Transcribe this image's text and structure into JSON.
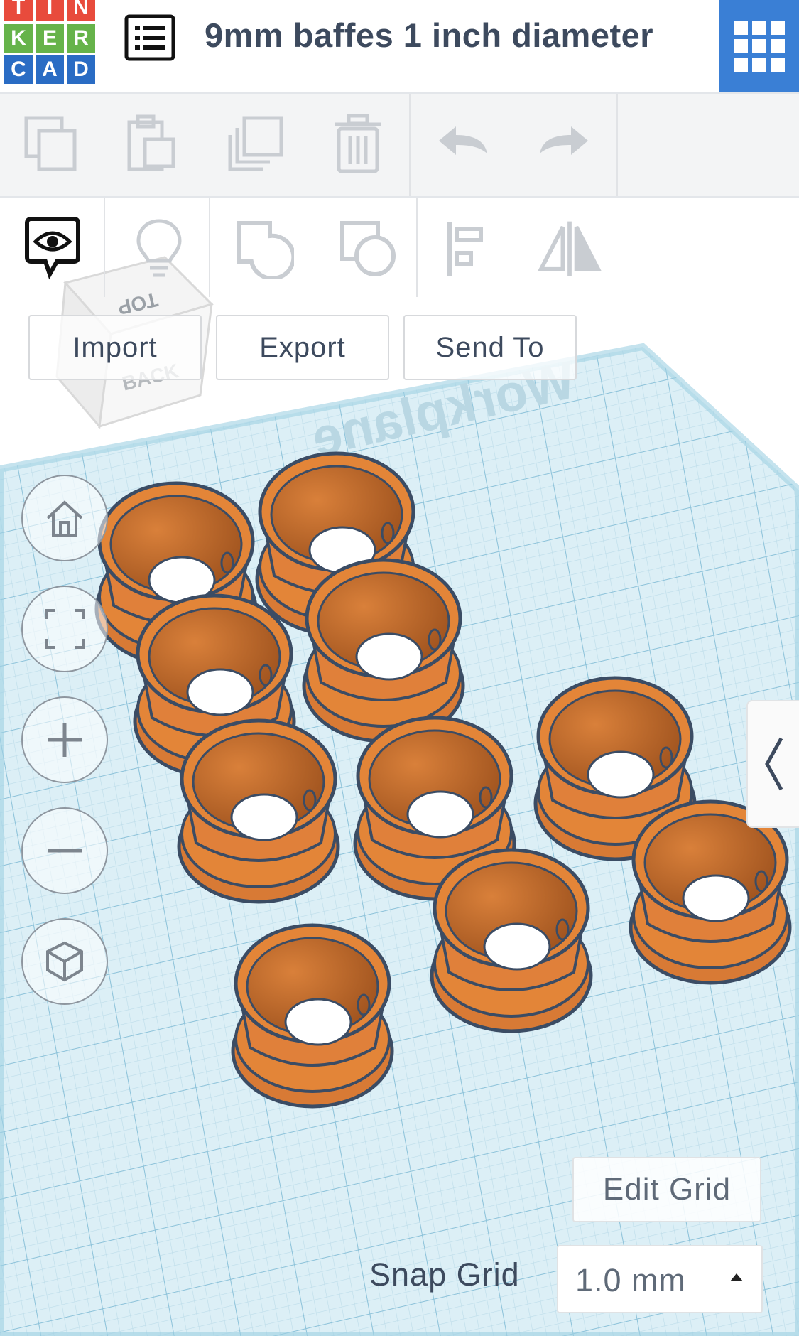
{
  "app": {
    "logo_letters": [
      "T",
      "I",
      "N",
      "K",
      "E",
      "R",
      "C",
      "A",
      "D"
    ],
    "logo_colors": [
      "#e84b3c",
      "#e84b3c",
      "#e84b3c",
      "#66b34a",
      "#66b34a",
      "#66b34a",
      "#2a6cc4",
      "#2a6cc4",
      "#2a6cc4"
    ],
    "design_title": "9mm baffes 1 inch diameter",
    "accent_color": "#3a7fd5"
  },
  "toolbar": {
    "icons": [
      "copy-icon",
      "paste-icon",
      "duplicate-icon",
      "delete-icon",
      "undo-icon",
      "redo-icon"
    ]
  },
  "toolbar2": {
    "icons": [
      "show-all-icon",
      "light-bulb-icon",
      "group-icon",
      "ungroup-icon",
      "align-icon",
      "mirror-icon"
    ],
    "import_label": "Import",
    "export_label": "Export",
    "send_to_label": "Send To"
  },
  "viewcube": {
    "top_label": "TOP",
    "back_label": "BACK"
  },
  "workplane": {
    "label": "Workplane",
    "grid_color": "#bfe0ee",
    "object_color": "#e38035"
  },
  "view_controls": [
    "home-icon",
    "fit-view-icon",
    "zoom-in-icon",
    "zoom-out-icon",
    "perspective-icon"
  ],
  "grid": {
    "edit_label": "Edit Grid",
    "snap_label": "Snap Grid",
    "snap_value": "1.0 mm"
  }
}
